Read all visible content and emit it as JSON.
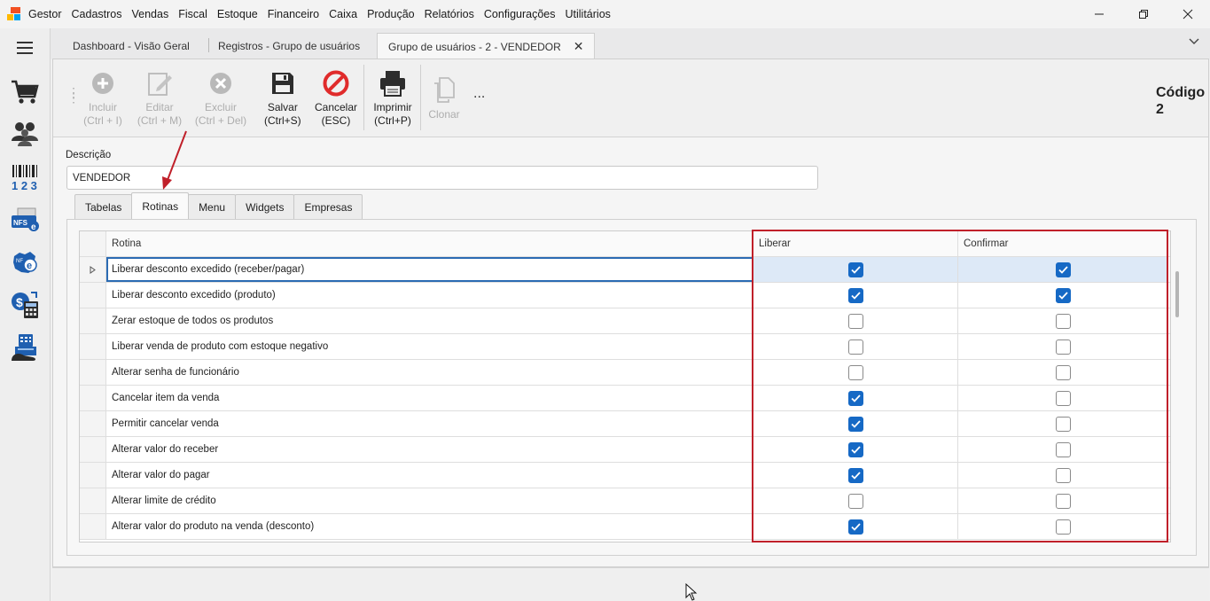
{
  "app": {
    "name": "Gestor",
    "menu": [
      "Cadastros",
      "Vendas",
      "Fiscal",
      "Estoque",
      "Financeiro",
      "Caixa",
      "Produção",
      "Relatórios",
      "Configurações",
      "Utilitários"
    ],
    "window_controls": [
      "minimize-icon",
      "restore-icon",
      "close-icon"
    ]
  },
  "sidebar": {
    "icons": [
      "hamburger-menu-icon",
      "shopping-cart-icon",
      "users-icon",
      "barcode-icon",
      "nfse-icon",
      "nfe-icon",
      "finance-calculator-icon",
      "cash-register-icon"
    ]
  },
  "doc_tabs": [
    {
      "label": "Dashboard - Visão Geral",
      "active": false
    },
    {
      "label": "Registros - Grupo de usuários",
      "active": false
    },
    {
      "label": "Grupo de usuários - 2 - VENDEDOR",
      "active": true
    }
  ],
  "toolbar": {
    "incluir": {
      "line1": "Incluir",
      "line2": "(Ctrl + I)"
    },
    "editar": {
      "line1": "Editar",
      "line2": "(Ctrl + M)"
    },
    "excluir": {
      "line1": "Excluir",
      "line2": "(Ctrl + Del)"
    },
    "salvar": {
      "line1": "Salvar",
      "line2": "(Ctrl+S)"
    },
    "cancelar": {
      "line1": "Cancelar",
      "line2": "(ESC)"
    },
    "imprimir": {
      "line1": "Imprimir",
      "line2": "(Ctrl+P)"
    },
    "clonar": {
      "line1": "Clonar"
    },
    "more": "...",
    "codigo_label": "Código",
    "codigo_value": "2"
  },
  "form": {
    "descricao_label": "Descrição",
    "descricao_value": "VENDEDOR"
  },
  "subtabs": [
    {
      "label": "Tabelas",
      "active": false
    },
    {
      "label": "Rotinas",
      "active": true
    },
    {
      "label": "Menu",
      "active": false
    },
    {
      "label": "Widgets",
      "active": false
    },
    {
      "label": "Empresas",
      "active": false
    }
  ],
  "grid": {
    "columns": [
      "Rotina",
      "Liberar",
      "Confirmar"
    ],
    "rows": [
      {
        "rotina": "Liberar desconto excedido (receber/pagar)",
        "liberar": true,
        "confirmar": true
      },
      {
        "rotina": "Liberar desconto excedido (produto)",
        "liberar": true,
        "confirmar": true
      },
      {
        "rotina": "Zerar estoque de todos os produtos",
        "liberar": false,
        "confirmar": false
      },
      {
        "rotina": "Liberar venda de produto com estoque negativo",
        "liberar": false,
        "confirmar": false
      },
      {
        "rotina": "Alterar senha de funcionário",
        "liberar": false,
        "confirmar": false
      },
      {
        "rotina": "Cancelar item da venda",
        "liberar": true,
        "confirmar": false
      },
      {
        "rotina": "Permitir cancelar venda",
        "liberar": true,
        "confirmar": false
      },
      {
        "rotina": "Alterar valor do receber",
        "liberar": true,
        "confirmar": false
      },
      {
        "rotina": "Alterar valor do pagar",
        "liberar": true,
        "confirmar": false
      },
      {
        "rotina": "Alterar limite de crédito",
        "liberar": false,
        "confirmar": false
      },
      {
        "rotina": "Alterar valor do produto na venda (desconto)",
        "liberar": true,
        "confirmar": false
      }
    ]
  },
  "colors": {
    "checkbox_checked": "#1669c5",
    "annotation_red": "#c0202a",
    "selected_row": "#dde9f7"
  }
}
